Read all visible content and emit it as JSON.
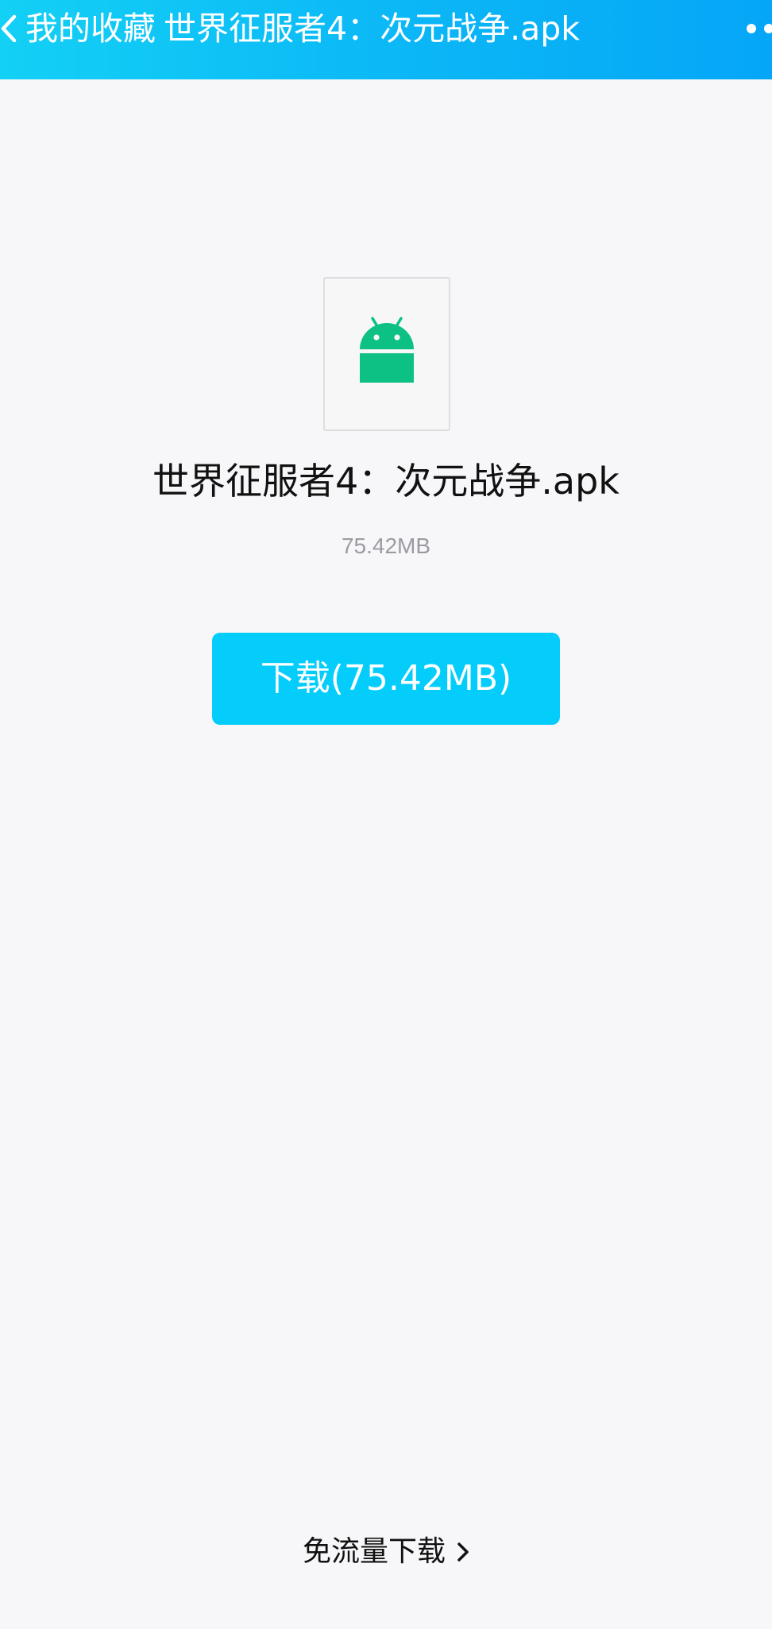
{
  "header": {
    "back_icon": "chevron-left-icon",
    "section": "我的收藏",
    "title": "世界征服者4：次元战争.apk",
    "more_icon": "more-dots-icon"
  },
  "file": {
    "icon": "android-icon",
    "name": "世界征服者4：次元战争.apk",
    "size": "75.42MB"
  },
  "actions": {
    "download_label": "下载(75.42MB)",
    "free_download_label": "免流量下载",
    "free_download_icon": "chevron-right-icon"
  },
  "colors": {
    "header_gradient_start": "#13d0f5",
    "header_gradient_end": "#05a6f7",
    "download_button": "#04cdfb",
    "android_green": "#0dc184",
    "background": "#f7f7f9"
  }
}
